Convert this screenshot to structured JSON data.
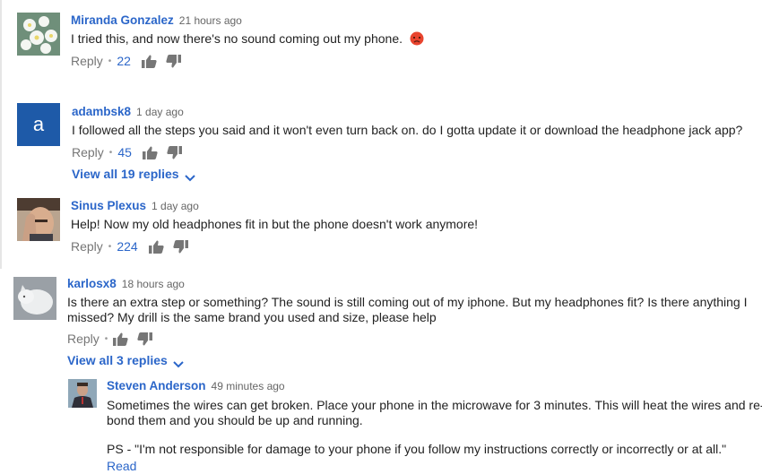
{
  "comments": [
    {
      "author": "Miranda Gonzalez",
      "time": "21 hours ago",
      "text": "I tried this, and now there's no sound coming out my phone.",
      "emoji": "angry-face",
      "reply_label": "Reply",
      "likes": "22"
    },
    {
      "author": "adambsk8",
      "avatar_letter": "a",
      "time": "1 day ago",
      "text": "I followed all the steps you said and it won't even turn back on. do I gotta update it or download the headphone jack app?",
      "reply_label": "Reply",
      "likes": "45",
      "view_replies": "View all 19 replies"
    },
    {
      "author": "Sinus Plexus",
      "time": "1 day ago",
      "text": "Help! Now my old headphones fit in but the phone doesn't work anymore!",
      "reply_label": "Reply",
      "likes": "224"
    },
    {
      "author": "karlosx8",
      "time": "18 hours ago",
      "text_line1": "Is there an extra step or something? The sound is still coming out of my iphone. But my headphones fit? Is there anything I",
      "text_line2": "missed? My drill is the same brand you used and size, please help",
      "reply_label": "Reply",
      "view_replies": "View all 3 replies"
    }
  ],
  "reply": {
    "author": "Steven Anderson",
    "time": "49 minutes ago",
    "text_line1": "Sometimes the wires can get broken. Place your phone in the microwave for 3 minutes. This will heat the wires and re-",
    "text_line2": "bond them and you should be up and running.",
    "text_ps": "PS - \"I'm not responsible for damage to your phone if you follow my instructions correctly or incorrectly or at all.\"",
    "read_more": "Read more"
  },
  "colors": {
    "link": "#2b66c9",
    "muted": "#767676",
    "letter_avatar_bg": "#1e5aa8"
  }
}
